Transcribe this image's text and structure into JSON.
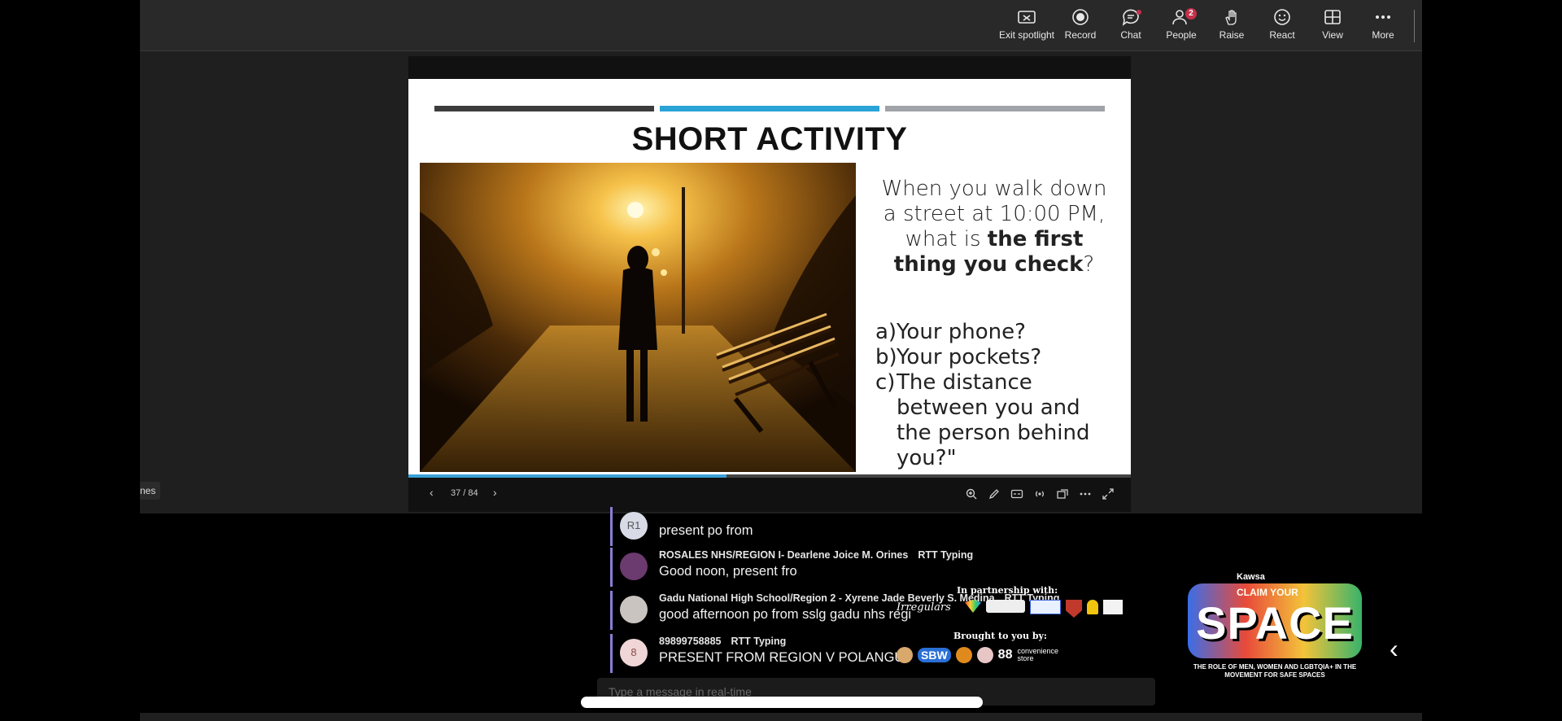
{
  "toolbar": {
    "exit_spotlight": "Exit spotlight",
    "record": "Record",
    "chat": "Chat",
    "people": "People",
    "people_count": "2",
    "raise": "Raise",
    "react": "React",
    "view": "View",
    "more": "More"
  },
  "slide": {
    "title": "SHORT ACTIVITY",
    "question_pre": "When you walk down a street at 10:00 PM, what is ",
    "question_bold": "the first thing you check",
    "question_post": "?",
    "options": [
      {
        "key": "a)",
        "text": "Your phone?"
      },
      {
        "key": "b)",
        "text": "Your pockets?"
      },
      {
        "key": "c)",
        "text": "The distance between you and the person behind you?\""
      }
    ],
    "page_indicator": "37 / 84",
    "progress": 0.44,
    "bar_colors": [
      "#3c3c3c",
      "#2aa3d6",
      "#a0a3a8"
    ]
  },
  "participant_tag": "nes",
  "chat": {
    "messages": [
      {
        "initials": "R1",
        "sender": "",
        "status": "",
        "text": "present po from"
      },
      {
        "initials": "",
        "sender": "ROSALES NHS/REGION I- Dearlene Joice M. Orines",
        "status": "RTT Typing",
        "text": "Good noon, present fro"
      },
      {
        "initials": "",
        "sender": "Gadu National High School/Region 2 - Xyrene Jade Beverly S. Medina",
        "status": "RTT Typing",
        "text": "good afternoon po from sslg gadu nhs regi"
      },
      {
        "initials": "8",
        "sender": "89899758885",
        "status": "RTT Typing",
        "text": "PRESENT FROM REGION V POLANGUI"
      }
    ],
    "composer_placeholder": "Type a message in real-time"
  },
  "overlay": {
    "partnership": "In partnership with:",
    "partner_name": "Irregulars",
    "brought": "Brought to you by:",
    "sponsor_sbw": "SBW",
    "sponsor_88": "88",
    "sponsor_store": "convenience store",
    "logo_top": "Kawsa",
    "logo_claim": "CLAIM YOUR",
    "logo_space": "SPACE",
    "logo_tagline": "THE ROLE OF MEN, WOMEN AND LGBTQIA+ IN THE MOVEMENT FOR SAFE SPACES"
  }
}
